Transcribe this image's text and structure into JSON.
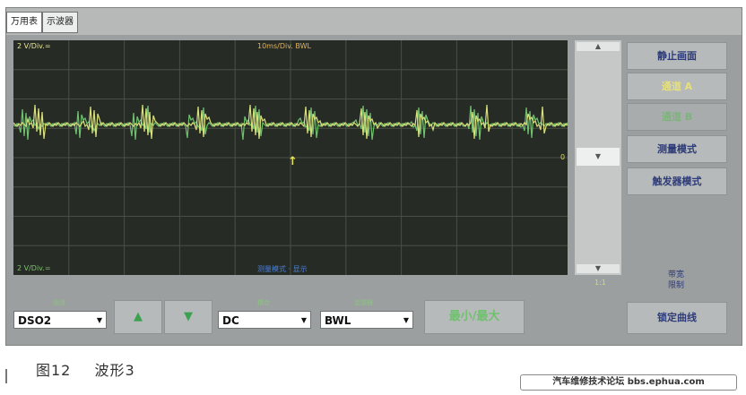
{
  "tabs": [
    {
      "label": "万用表"
    },
    {
      "label": "示波器"
    }
  ],
  "scope": {
    "ch_a_scale": "2 V/Div.=",
    "timebase": "10ms/Div. BWL",
    "ch_b_scale": "2 V/Div.=",
    "bottom_label": "测量模式 · 显示",
    "zero_marker": "0",
    "trigger_marker": "↑"
  },
  "scrollbar": {
    "up": "▲",
    "thumb": "▼",
    "down": "▼",
    "value": "1:1"
  },
  "side_buttons": {
    "freeze": "静止画面",
    "channel_a": "通道 A",
    "channel_b": "通道 B",
    "measure_mode": "测量模式",
    "trigger_mode": "触发器模式",
    "note_line1": "带宽",
    "note_line2": "限制",
    "lock_curve": "锁定曲线"
  },
  "controls": {
    "dso_label": "通道",
    "dso_value": "DSO2",
    "up_arrow": "▲",
    "down_arrow": "▼",
    "coupling_label": "耦合",
    "coupling_value": "DC",
    "filter_label": "滤波器",
    "filter_value": "BWL",
    "minmax": "最小/最大"
  },
  "caption": {
    "figure": "图12",
    "title": "波形3"
  },
  "watermark": "汽车维修技术论坛 bbs.ephua.com",
  "colors": {
    "scope_bg": "#272b25",
    "trace_yellow": "#d9e07a",
    "trace_green": "#6fc16e",
    "grid": "#4a4f46"
  }
}
